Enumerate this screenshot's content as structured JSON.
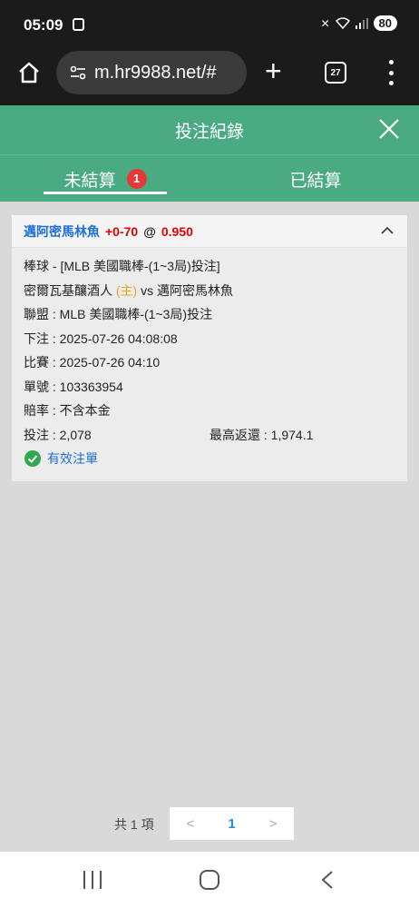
{
  "status_bar": {
    "time": "05:09",
    "battery": "80"
  },
  "browser": {
    "url": "m.hr9988.net/#",
    "tab_count": "27"
  },
  "header": {
    "title": "投注紀錄"
  },
  "tabs": [
    {
      "label": "未結算",
      "badge": "1"
    },
    {
      "label": "已結算"
    }
  ],
  "bet": {
    "pick": "邁阿密馬林魚",
    "handicap": "+0-70",
    "at": "@",
    "odds": "0.950",
    "sport_line": "棒球 - [MLB 美國職棒-(1~3局)投注]",
    "match": {
      "home_team": "密爾瓦基釀酒人",
      "home_tag": "(主)",
      "vs": "vs",
      "away_team": "邁阿密馬林魚"
    },
    "league": "聯盟 : MLB 美國職棒-(1~3局)投注",
    "bet_time": "下注 : 2025-07-26 04:08:08",
    "match_time": "比賽 : 2025-07-26 04:10",
    "ticket_no": "單號 : 103363954",
    "odds_type": "賠率 : 不含本金",
    "stake": "投注 : 2,078",
    "max_return": "最高返還 : 1,974.1",
    "status": "有效注單"
  },
  "pagination": {
    "total": "共 1 項",
    "prev": "<",
    "current": "1",
    "next": ">"
  },
  "colors": {
    "header": "#4aaa82",
    "accent_blue": "#1e6fd9",
    "accent_red": "#e00000",
    "home_tag": "#f0a020",
    "badge": "#e53935"
  }
}
